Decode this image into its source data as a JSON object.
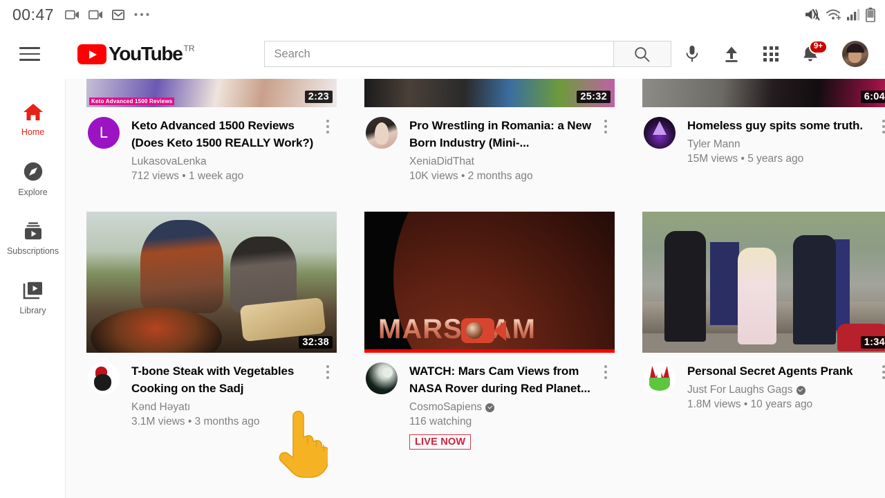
{
  "statusbar": {
    "clock": "00:47",
    "left_icons": [
      "video-camera-icon",
      "video-camera-icon",
      "gmail-icon",
      "more-dots-icon"
    ],
    "right_icons": [
      "volume-mute-icon",
      "wifi-icon",
      "cell-signal-icon",
      "battery-icon"
    ]
  },
  "header": {
    "menu_icon": "hamburger-menu-icon",
    "logo_text": "YouTube",
    "logo_country": "TR",
    "search": {
      "value": "",
      "placeholder": "Search"
    },
    "search_icon": "search-icon",
    "voice_icon": "microphone-icon",
    "upload_icon": "upload-icon",
    "apps_icon": "apps-grid-icon",
    "notifications_icon": "bell-icon",
    "notifications_badge": "9+",
    "avatar": "user-avatar"
  },
  "sidebar": {
    "items": [
      {
        "label": "Home",
        "icon": "home-icon",
        "active": true
      },
      {
        "label": "Explore",
        "icon": "compass-icon",
        "active": false
      },
      {
        "label": "Subscriptions",
        "icon": "subscriptions-icon",
        "active": false
      },
      {
        "label": "Library",
        "icon": "library-icon",
        "active": false
      }
    ]
  },
  "videos": [
    {
      "title": "Keto Advanced 1500 Reviews (Does Keto 1500 REALLY Work?)",
      "channel": "LukasovaLenka",
      "verified": false,
      "stats": "712 views • 1 week ago",
      "duration": "2:23",
      "avatar_letter": "L",
      "thumb_caption": "Keto Advanced 1500 Reviews",
      "live": false
    },
    {
      "title": "Pro Wrestling in Romania: a New Born Industry (Mini-...",
      "channel": "XeniaDidThat",
      "verified": false,
      "stats": "10K views • 2 months ago",
      "duration": "25:32",
      "live": false
    },
    {
      "title": "Homeless guy spits some truth.",
      "channel": "Tyler Mann",
      "verified": false,
      "stats": "15M views • 5 years ago",
      "duration": "6:04",
      "live": false
    },
    {
      "title": "T-bone Steak with Vegetables Cooking on the Sadj",
      "channel": "Kənd Həyatı",
      "verified": false,
      "stats": "3.1M views • 3 months ago",
      "duration": "32:38",
      "live": false
    },
    {
      "title": "WATCH: Mars Cam Views from NASA Rover during Red Planet...",
      "channel": "CosmoSapiens",
      "verified": true,
      "stats": "116 watching",
      "duration": "",
      "live": true,
      "live_label": "LIVE NOW",
      "thumb_text": "MARS CAM"
    },
    {
      "title": "Personal Secret Agents Prank",
      "channel": "Just For Laughs Gags",
      "verified": true,
      "stats": "1.8M views • 10 years ago",
      "duration": "1:34",
      "live": false
    }
  ],
  "cursor": {
    "icon": "pointing-hand-cursor"
  },
  "colors": {
    "brand_red": "#ff0000",
    "active_red": "#e62117",
    "badge_red": "#cc0000",
    "live_red": "#cc2340",
    "text_primary": "#030303",
    "text_secondary": "#808080",
    "page_bg": "#fafafa"
  }
}
